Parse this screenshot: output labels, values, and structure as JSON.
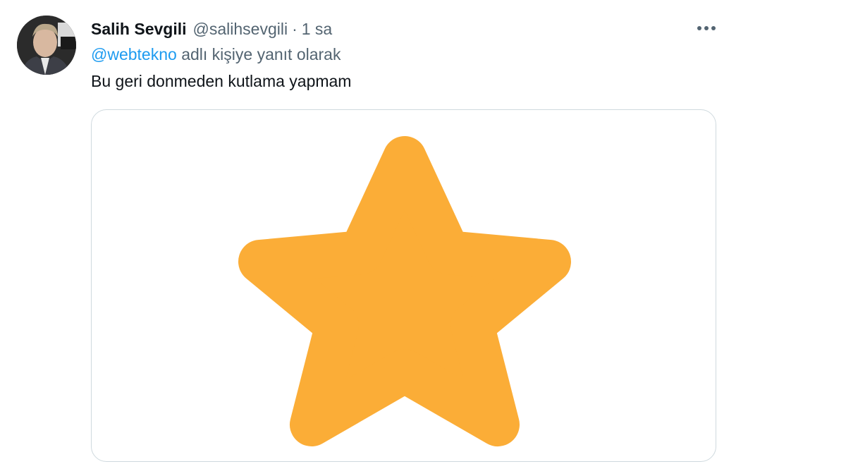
{
  "tweet": {
    "author": {
      "display_name": "Salih Sevgili",
      "handle": "@salihsevgili",
      "avatar_icon": "user-photo"
    },
    "separator": "·",
    "timestamp": "1 sa",
    "more_icon": "more-horizontal-icon",
    "reply_to": {
      "mention": "@webtekno",
      "suffix": " adlı kişiye yanıt olarak"
    },
    "text": "Bu geri donmeden kutlama yapmam",
    "media": {
      "icon": "star-icon",
      "star_color": "#fbad37"
    }
  },
  "colors": {
    "mention": "#1d9bf0",
    "secondary_text": "#536471",
    "primary_text": "#0f1419",
    "border": "#cfd9de"
  }
}
